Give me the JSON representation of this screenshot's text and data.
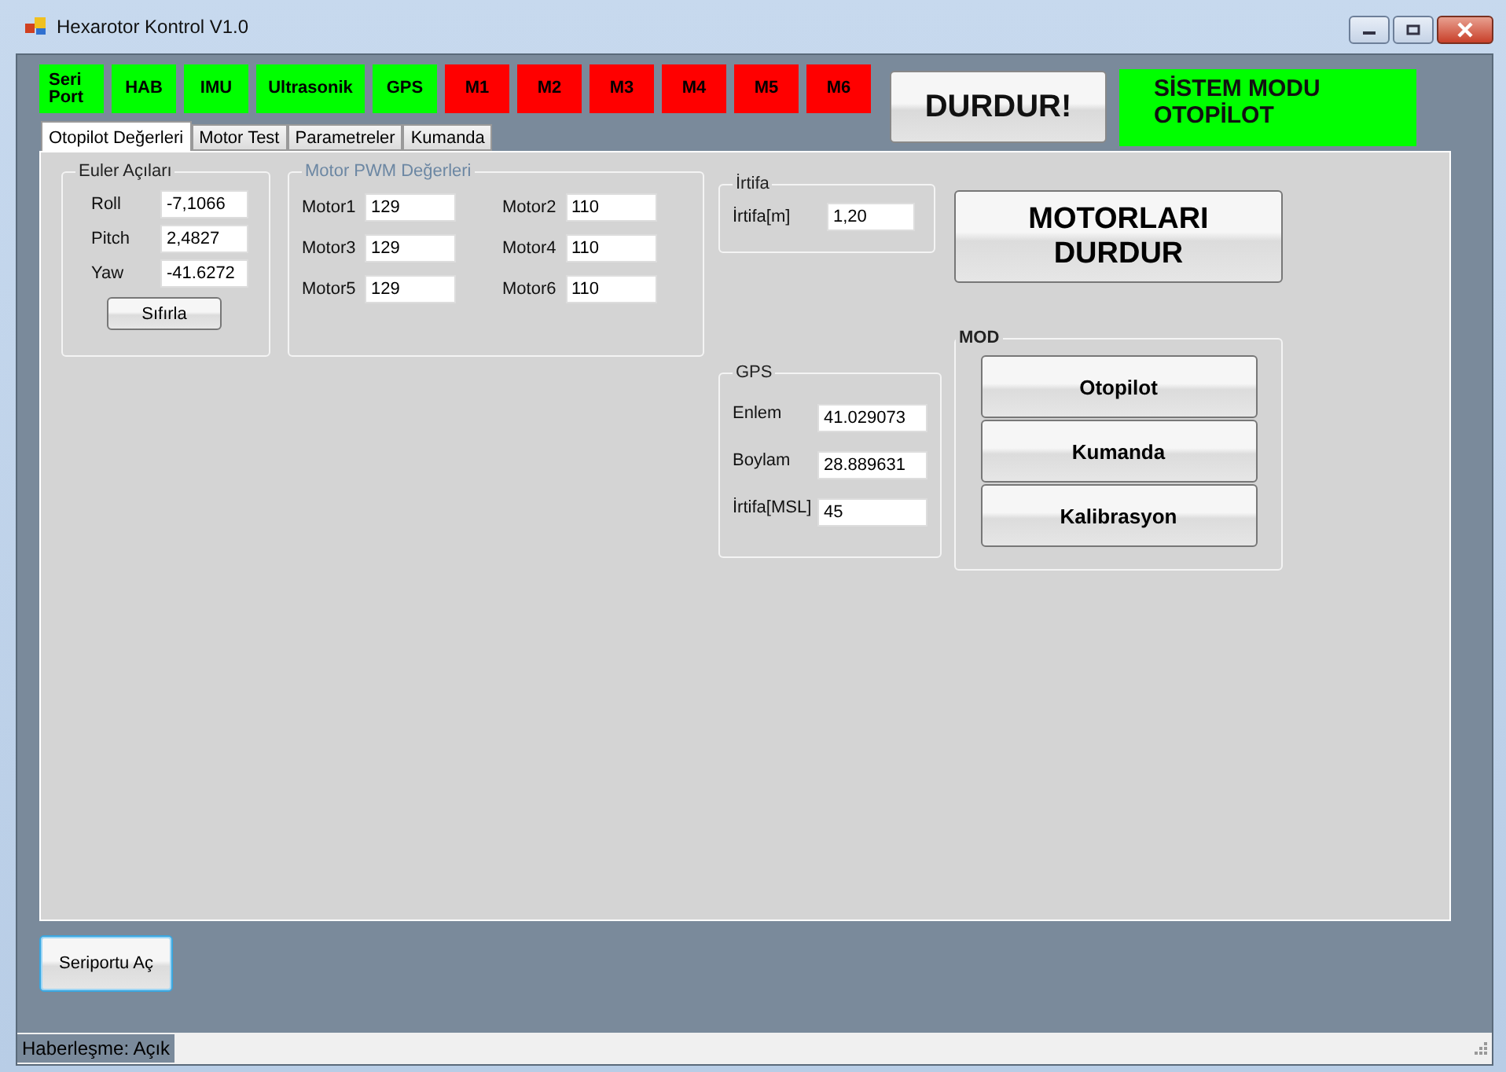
{
  "window": {
    "title": "Hexarotor Kontrol V1.0"
  },
  "indicators": [
    {
      "label": "Seri Port",
      "color": "#00ff00"
    },
    {
      "label": "HAB",
      "color": "#00ff00"
    },
    {
      "label": "IMU",
      "color": "#00ff00"
    },
    {
      "label": "Ultrasonik",
      "color": "#00ff00"
    },
    {
      "label": "GPS",
      "color": "#00ff00"
    },
    {
      "label": "M1",
      "color": "#ff0000"
    },
    {
      "label": "M2",
      "color": "#ff0000"
    },
    {
      "label": "M3",
      "color": "#ff0000"
    },
    {
      "label": "M4",
      "color": "#ff0000"
    },
    {
      "label": "M5",
      "color": "#ff0000"
    },
    {
      "label": "M6",
      "color": "#ff0000"
    }
  ],
  "stop_button": "DURDUR!",
  "system_mode": {
    "lines": [
      "SİSTEM MODU",
      "OTOPİLOT"
    ]
  },
  "tabs": [
    {
      "label": "Otopilot Değerleri",
      "selected": true
    },
    {
      "label": "Motor Test",
      "selected": false
    },
    {
      "label": "Parametreler",
      "selected": false
    },
    {
      "label": "Kumanda",
      "selected": false
    }
  ],
  "euler": {
    "title": "Euler Açıları",
    "rows": [
      {
        "label": "Roll",
        "value": "-7,1066"
      },
      {
        "label": "Pitch",
        "value": "2,4827"
      },
      {
        "label": "Yaw",
        "value": "-41.6272"
      }
    ],
    "reset_button": "Sıfırla"
  },
  "motor_pwm": {
    "title": "Motor PWM Değerleri",
    "disabled": true,
    "motors": [
      {
        "label": "Motor1",
        "value": "129"
      },
      {
        "label": "Motor2",
        "value": "110"
      },
      {
        "label": "Motor3",
        "value": "129"
      },
      {
        "label": "Motor4",
        "value": "110"
      },
      {
        "label": "Motor5",
        "value": "129"
      },
      {
        "label": "Motor6",
        "value": "110"
      }
    ]
  },
  "altitude": {
    "title": "İrtifa",
    "rows": [
      {
        "label": "İrtifa[m]",
        "value": "1,20"
      }
    ]
  },
  "gps": {
    "title": "GPS",
    "rows": [
      {
        "label": "Enlem",
        "value": "41.029073"
      },
      {
        "label": "Boylam",
        "value": "28.889631"
      },
      {
        "label": "İrtifa[MSL]",
        "value": "45"
      }
    ]
  },
  "motors_stop_button": "MOTORLARI DURDUR",
  "mode": {
    "title": "MOD",
    "buttons": [
      "Otopilot",
      "Kumanda",
      "Kalibrasyon"
    ]
  },
  "serial_button": "Seriportu Aç",
  "status_bar": {
    "text": "Haberleşme: Açık"
  }
}
